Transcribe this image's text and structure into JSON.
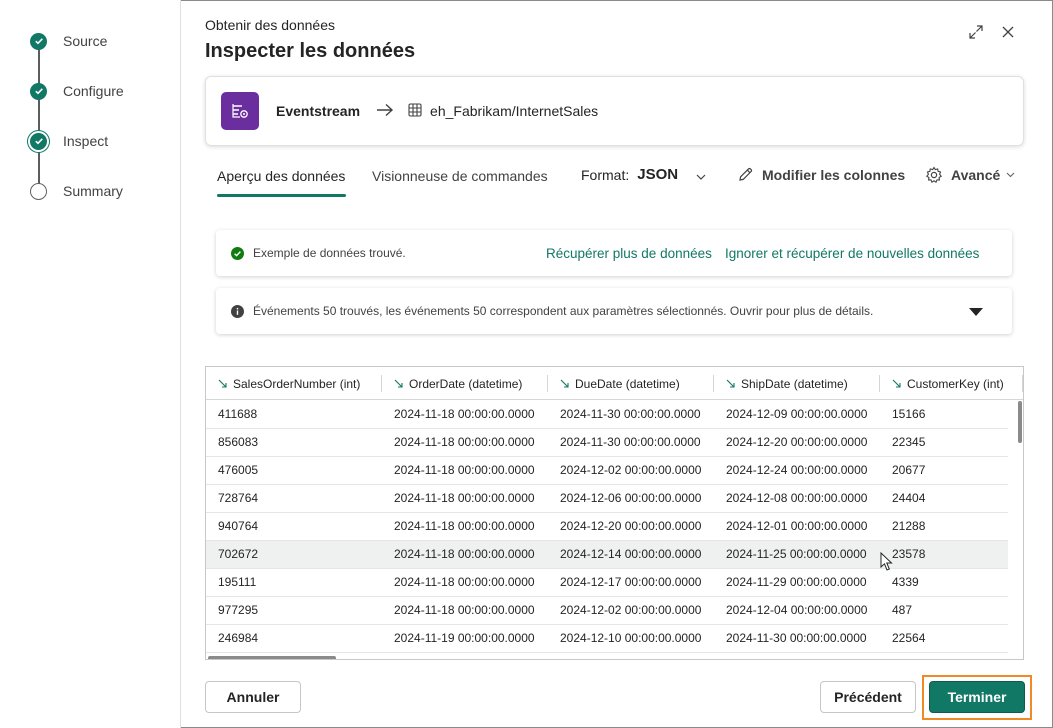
{
  "stepper": {
    "steps": [
      {
        "label": "Source",
        "state": "done"
      },
      {
        "label": "Configure",
        "state": "done"
      },
      {
        "label": "Inspect",
        "state": "current"
      },
      {
        "label": "Summary",
        "state": "todo"
      }
    ]
  },
  "header": {
    "supertitle": "Obtenir des données",
    "title": "Inspecter les données"
  },
  "source": {
    "name": "Eventstream",
    "path": "eh_Fabrikam/InternetSales"
  },
  "tabs": {
    "preview": "Aperçu des données",
    "commands": "Visionneuse de commandes"
  },
  "toolbar": {
    "format_label": "Format:",
    "format_value": "JSON",
    "edit_columns": "Modifier les colonnes",
    "advanced": "Avancé"
  },
  "messages": {
    "found": "Exemple de données trouvé.",
    "fetch_more": "Récupérer plus de données",
    "discard_fetch": "Ignorer et récupérer de nouvelles données",
    "events": "Événements 50 trouvés, les événements 50 correspondent aux paramètres sélectionnés. Ouvrir pour plus de détails."
  },
  "grid": {
    "columns": [
      "SalesOrderNumber (int)",
      "OrderDate (datetime)",
      "DueDate (datetime)",
      "ShipDate (datetime)",
      "CustomerKey (int)"
    ],
    "rows": [
      [
        "411688",
        "2024-11-18 00:00:00.0000",
        "2024-11-30 00:00:00.0000",
        "2024-12-09 00:00:00.0000",
        "15166"
      ],
      [
        "856083",
        "2024-11-18 00:00:00.0000",
        "2024-11-30 00:00:00.0000",
        "2024-12-20 00:00:00.0000",
        "22345"
      ],
      [
        "476005",
        "2024-11-18 00:00:00.0000",
        "2024-12-02 00:00:00.0000",
        "2024-12-24 00:00:00.0000",
        "20677"
      ],
      [
        "728764",
        "2024-11-18 00:00:00.0000",
        "2024-12-06 00:00:00.0000",
        "2024-12-08 00:00:00.0000",
        "24404"
      ],
      [
        "940764",
        "2024-11-18 00:00:00.0000",
        "2024-12-20 00:00:00.0000",
        "2024-12-01 00:00:00.0000",
        "21288"
      ],
      [
        "702672",
        "2024-11-18 00:00:00.0000",
        "2024-12-14 00:00:00.0000",
        "2024-11-25 00:00:00.0000",
        "23578"
      ],
      [
        "195111",
        "2024-11-18 00:00:00.0000",
        "2024-12-17 00:00:00.0000",
        "2024-11-29 00:00:00.0000",
        "4339"
      ],
      [
        "977295",
        "2024-11-18 00:00:00.0000",
        "2024-12-02 00:00:00.0000",
        "2024-12-04 00:00:00.0000",
        "487"
      ],
      [
        "246984",
        "2024-11-19 00:00:00.0000",
        "2024-12-10 00:00:00.0000",
        "2024-11-30 00:00:00.0000",
        "22564"
      ]
    ],
    "highlighted_row": 5
  },
  "footer": {
    "cancel": "Annuler",
    "previous": "Précédent",
    "finish": "Terminer"
  },
  "colors": {
    "accent": "#117865",
    "eventstream_purple": "#6b2e9e",
    "focus_ring": "#f08a24"
  },
  "icons": [
    "check-icon",
    "expand-icon",
    "close-icon",
    "eventstream-icon",
    "arrow-right-icon",
    "table-icon",
    "chevron-down-icon",
    "pencil-icon",
    "gear-icon",
    "success-icon",
    "info-icon",
    "caret-down-icon",
    "column-type-icon",
    "mouse-cursor-icon"
  ]
}
